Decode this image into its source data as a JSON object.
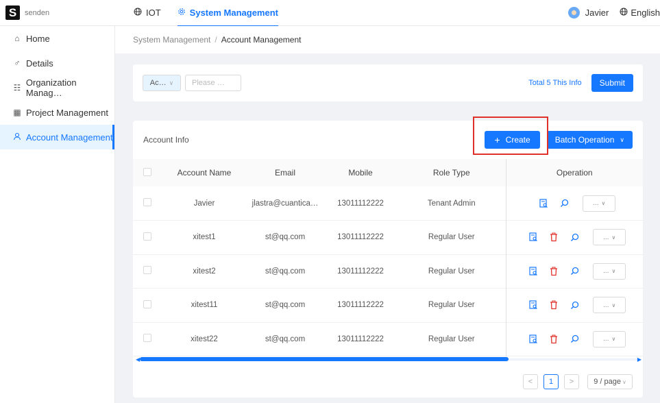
{
  "header": {
    "logo_text": "senden",
    "logo_letter": "S",
    "nav": [
      {
        "label": "IOT",
        "icon": "globe-icon"
      },
      {
        "label": "System Management",
        "icon": "gear-icon",
        "active": true
      }
    ],
    "user_name": "Javier",
    "language": "English"
  },
  "sidebar": {
    "items": [
      {
        "label": "Home",
        "icon": "home-icon"
      },
      {
        "label": "Details",
        "icon": "details-icon"
      },
      {
        "label": "Organization Manag…",
        "icon": "organization-icon"
      },
      {
        "label": "Project Management",
        "icon": "grid-icon"
      },
      {
        "label": "Account Management",
        "icon": "user-icon",
        "active": true
      }
    ]
  },
  "breadcrumb": {
    "parent": "System Management",
    "separator": "/",
    "current": "Account Management"
  },
  "filter": {
    "select_value": "Ac…",
    "input_placeholder": "Please …",
    "total_text": "Total 5 This Info",
    "submit_label": "Submit"
  },
  "table_card": {
    "title": "Account Info",
    "create_label": "Create",
    "batch_label": "Batch Operation",
    "columns": [
      "Account Name",
      "Email",
      "Mobile",
      "Role Type",
      "Operation"
    ],
    "rows": [
      {
        "name": "Javier",
        "email": "jlastra@cuantica…",
        "mobile": "13011112222",
        "role": "Tenant Admin",
        "deletable": false
      },
      {
        "name": "xitest1",
        "email": "st@qq.com",
        "mobile": "13011112222",
        "role": "Regular User",
        "deletable": true
      },
      {
        "name": "xitest2",
        "email": "st@qq.com",
        "mobile": "13011112222",
        "role": "Regular User",
        "deletable": true
      },
      {
        "name": "xitest11",
        "email": "st@qq.com",
        "mobile": "13011112222",
        "role": "Regular User",
        "deletable": true
      },
      {
        "name": "xitest22",
        "email": "st@qq.com",
        "mobile": "13011112222",
        "role": "Regular User",
        "deletable": true
      }
    ],
    "more_label": "...",
    "pagination": {
      "current_page": "1",
      "page_size": "9 / page"
    }
  },
  "colors": {
    "primary": "#1677ff",
    "danger": "#e0302a",
    "highlight_box": "#e0302a"
  }
}
